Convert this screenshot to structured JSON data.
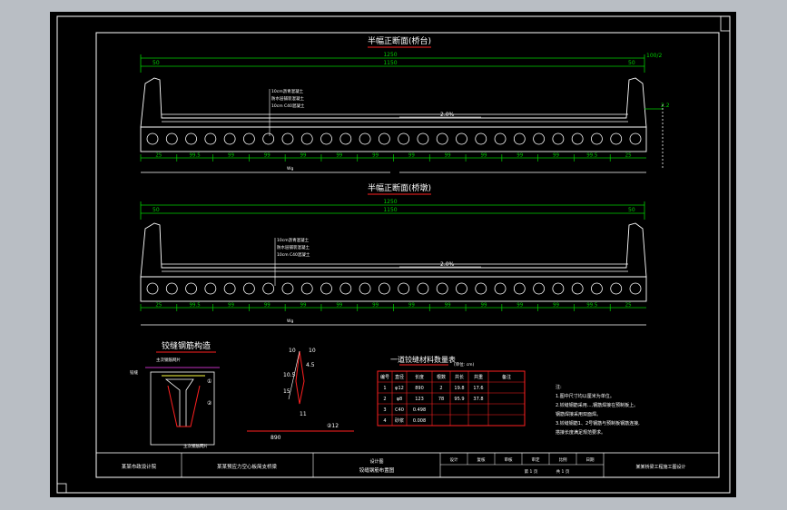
{
  "colors": {
    "canvas_bg": "#b9bec4",
    "sheet_bg": "#000000",
    "line": "#ffffff",
    "dim": "#00d000",
    "red": "#ff2020",
    "magenta": "#ff40ff",
    "yellow": "#ffff40"
  },
  "section_top": {
    "title": "半幅正断面(桥台)",
    "dim_total": "1250",
    "dim_inner": "1150",
    "dim_left": "50",
    "dim_right": "50",
    "dim_right_extra": "100/2",
    "slope_label": "2.0%",
    "side_label": "2.2",
    "leader_notes": [
      "10cm沥青混凝土",
      "防水层铺装混凝土",
      "10cm C40混凝土"
    ],
    "bottom_dims": [
      "25",
      "99.5",
      "99",
      "99",
      "99",
      "99",
      "99",
      "99",
      "99",
      "99",
      "99",
      "99",
      "99.5",
      "25"
    ],
    "bottom_note": "Wg"
  },
  "section_bottom": {
    "title": "半幅正断面(桥墩)",
    "dim_total": "1250",
    "dim_inner": "1150",
    "dim_left": "50",
    "dim_right": "50",
    "slope_label": "2.0%",
    "leader_notes": [
      "10cm沥青混凝土",
      "防水层铺装混凝土",
      "10cm C40混凝土"
    ],
    "bottom_dims": [
      "25",
      "99.5",
      "99",
      "99",
      "99",
      "99",
      "99",
      "99",
      "99",
      "99",
      "99",
      "99",
      "99.5",
      "25"
    ],
    "bottom_note": "Wg"
  },
  "hinge_detail": {
    "title": "铰缝钢筋构造",
    "labels": [
      "主次钢筋网片",
      "铰缝",
      "主次钢筋网片"
    ],
    "note_a": "①",
    "note_b": "②"
  },
  "rebar_detail": {
    "dims": [
      "10",
      "10",
      "10.5",
      "15",
      "11"
    ],
    "slope": "4.5",
    "bottom_dim": "890",
    "bottom_note": "②12"
  },
  "quantity_table": {
    "title": "一道铰缝材料数量表",
    "note": "(单位: cm)",
    "headers": [
      "编号",
      "直径",
      "长度",
      "根数",
      "共长",
      "共重",
      "备注"
    ],
    "rows": [
      [
        "1",
        "φ12",
        "890",
        "2",
        "19.8",
        "17.6",
        ""
      ],
      [
        "2",
        "φ8",
        "123",
        "78",
        "95.9",
        "37.8",
        ""
      ],
      [
        "3",
        "C40",
        "0.498",
        "",
        "",
        "",
        ""
      ],
      [
        "4",
        "砂浆",
        "0.008",
        "",
        "",
        "",
        ""
      ]
    ]
  },
  "notes": [
    "注:",
    "1.图中尺寸均以厘米为单位。",
    "2.铰缝钢筋采用...,钢筋焊接在预制板上。",
    "  钢筋焊接采用双面焊。",
    "3.铰缝钢筋1、2号钢筋与预制板钢筋连接,",
    "  搭接长度满足规范要求。"
  ],
  "title_block": {
    "company": "某某市政设计院",
    "project": "某某预应力空心板简支桥梁",
    "drawing_sub": "设计图",
    "drawing_name": "铰缝钢筋布置图",
    "cells_top": [
      "设计",
      "复核",
      "审核",
      "审定",
      "比例",
      "日期"
    ],
    "cells_bottom": [
      "第 1 页",
      "共 1 页"
    ],
    "right_text": "某某桥梁工程施工图设计"
  }
}
